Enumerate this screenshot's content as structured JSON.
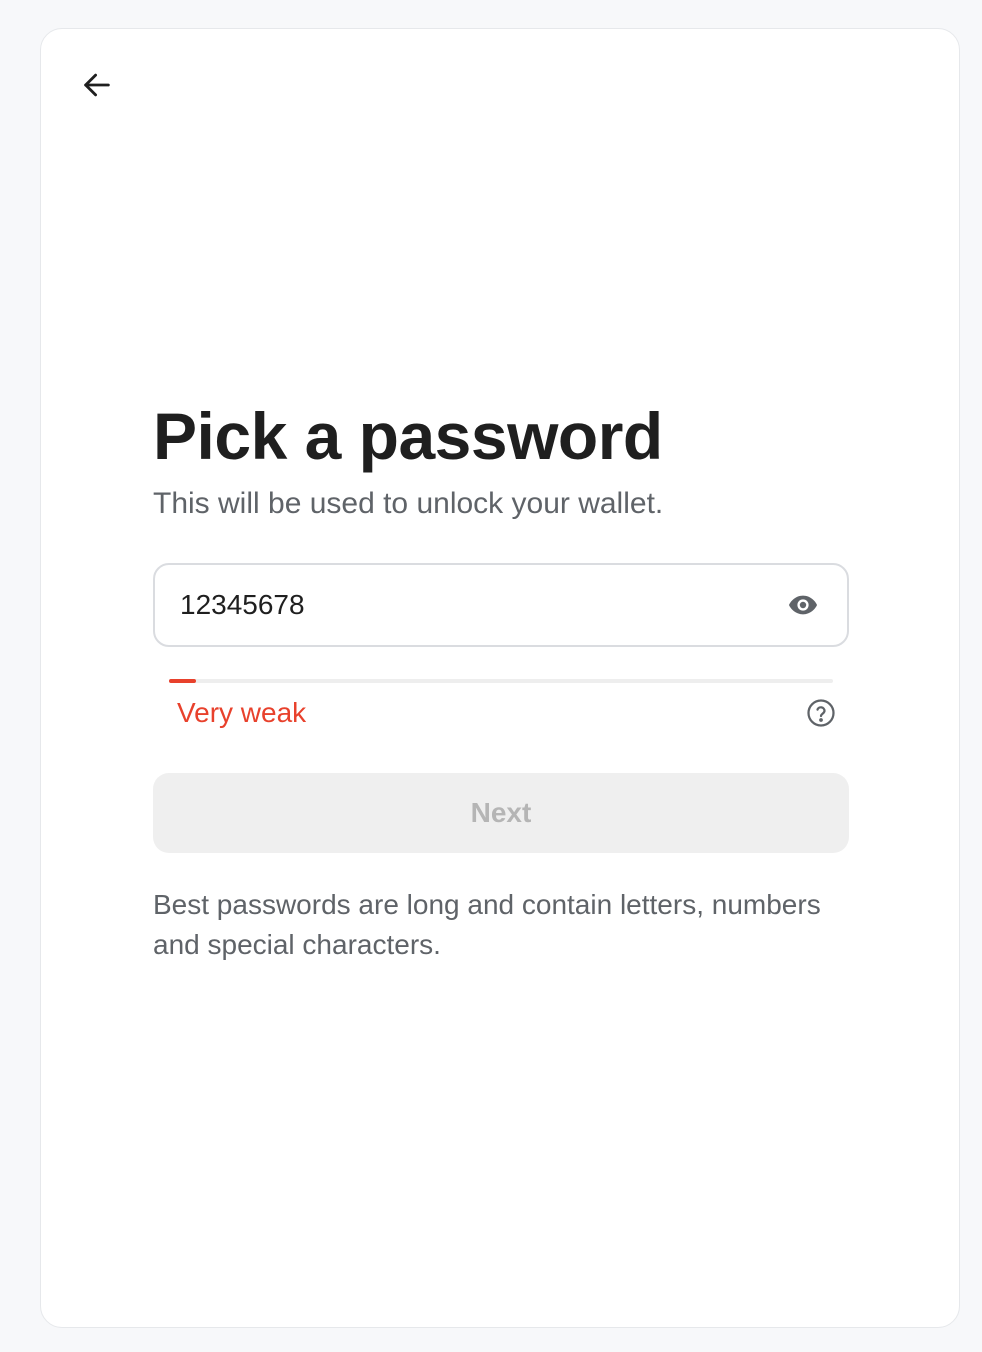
{
  "header": {
    "back_icon": "arrow-left-icon"
  },
  "main": {
    "title": "Pick a password",
    "subtitle": "This will be used to unlock your wallet.",
    "password": {
      "value": "12345678",
      "visibility_icon": "eye-icon"
    },
    "strength": {
      "label": "Very weak",
      "level": 0.04,
      "color": "#e8412c",
      "help_icon": "question-circle-icon"
    },
    "next_button": {
      "label": "Next",
      "disabled": true
    },
    "hint": "Best passwords are long and contain letters, numbers and special characters."
  }
}
